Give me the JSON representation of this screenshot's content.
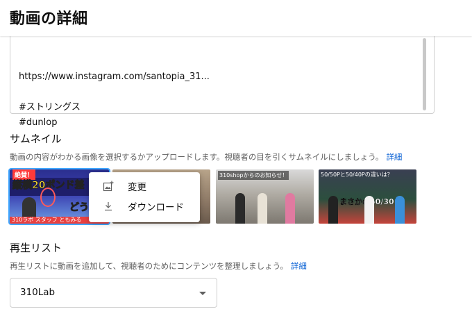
{
  "header": {
    "title": "動画の詳細"
  },
  "description": {
    "lines": [
      "https://www.instagram.com/santopia_31...",
      "",
      "#ストリングス",
      "#dunlop"
    ]
  },
  "thumbnail": {
    "title": "サムネイル",
    "subtitle": "動画の内容がわかる画像を選択するかアップロードします。視聴者の目を引くサムネイルにしましょう。",
    "link": "詳細",
    "items": [
      {
        "overlay_tag": "絶賛！",
        "overlay_line1": "縦横20ポンド差",
        "overlay_line2": "どうな",
        "overlay_bottom": "310ラボ スタッフ ともみる"
      },
      {
        "overlay": ""
      },
      {
        "overlay": "310shopからのお知らせ！"
      },
      {
        "overlay": "50/50Pと50/40Pの違いは？",
        "overlay_big": "まさかの50/30！"
      }
    ],
    "menu": {
      "change_label": "変更",
      "download_label": "ダウンロード",
      "change_icon": "add-photo-icon",
      "download_icon": "download-icon"
    }
  },
  "playlist": {
    "title": "再生リスト",
    "subtitle": "再生リストに動画を追加して、視聴者のためにコンテンツを整理しましょう。",
    "link": "詳細",
    "selected": "310Lab"
  },
  "colors": {
    "link": "#065fd4",
    "text": "#0f0f0f",
    "secondary": "#606060",
    "selected_outline": "#3ea6ff"
  }
}
